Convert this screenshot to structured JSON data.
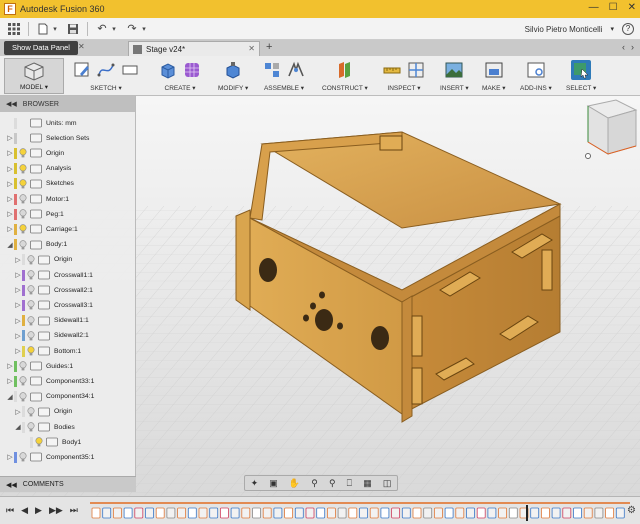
{
  "app": {
    "title": "Autodesk Fusion 360",
    "logo": "F"
  },
  "quickbar": {
    "user": "Silvio Pietro Monticelli"
  },
  "tabs": {
    "data_panel": "Show Data Panel",
    "document": "Stage v24*"
  },
  "ribbon": {
    "workspace": "MODEL",
    "groups": [
      "SKETCH",
      "CREATE",
      "MODIFY",
      "ASSEMBLE",
      "CONSTRUCT",
      "INSPECT",
      "INSERT",
      "MAKE",
      "ADD-INS",
      "SELECT"
    ]
  },
  "browser": {
    "title": "BROWSER",
    "items": [
      "Units: mm",
      "Selection Sets",
      "Origin",
      "Analysis",
      "Sketches",
      "Motor:1",
      "Peg:1",
      "Carriage:1",
      "Body:1",
      "Origin",
      "Crosswall1:1",
      "Crosswall2:1",
      "Crosswall3:1",
      "Sidewall1:1",
      "Sidewall2:1",
      "Bottom:1",
      "Guides:1",
      "Component33:1",
      "Component34:1",
      "Origin",
      "Bodies",
      "Body1",
      "Component35:1"
    ]
  },
  "comments": {
    "title": "COMMENTS"
  },
  "colors": {
    "title_bar": "#f2c12e",
    "wood": "#d9a54e",
    "wood_dark": "#b57f2e"
  }
}
